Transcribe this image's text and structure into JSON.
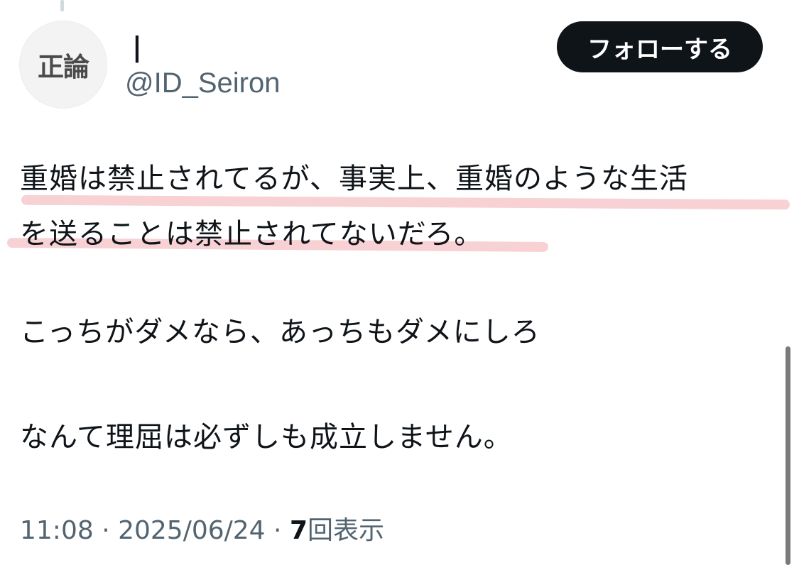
{
  "author": {
    "avatar_text": "正論",
    "display_name": "|",
    "handle": "@ID_Seiron"
  },
  "follow_button": {
    "label": "フォローする"
  },
  "tweet": {
    "lines": [
      "重婚は禁止されてるが、事実上、重婚のような生活",
      "を送ることは禁止されてないだろ。",
      "こっちがダメなら、あっちもダメにしろ",
      "なんて理屈は必ずしも成立しません。"
    ]
  },
  "meta": {
    "time": "11:08",
    "separator": " · ",
    "date": "2025/06/24",
    "views_count": "7",
    "views_label": "回表示"
  },
  "colors": {
    "text": "#0f1419",
    "secondary_text": "#536471",
    "button_bg": "#0f1419",
    "highlight": "#f7c9cc"
  }
}
